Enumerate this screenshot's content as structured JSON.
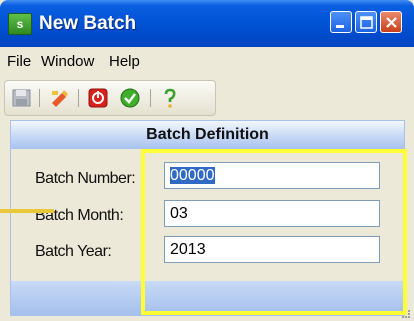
{
  "window": {
    "title": "New Batch",
    "icon_letter": "s"
  },
  "menu": {
    "items": [
      {
        "label": "File"
      },
      {
        "label": "Window"
      },
      {
        "label": "Help"
      }
    ]
  },
  "toolbar": {
    "icons": [
      "save-icon",
      "edit-icon",
      "stop-icon",
      "ok-icon",
      "help-icon"
    ]
  },
  "panel": {
    "title": "Batch Definition",
    "fields": [
      {
        "label": "Batch Number:",
        "value": "00000",
        "selected": true
      },
      {
        "label": "Batch Month:",
        "value": "03"
      },
      {
        "label": "Batch Year:",
        "value": "2013"
      }
    ]
  },
  "colors": {
    "highlight": "#ffff33",
    "title_bar": "#0254d7",
    "selection": "#316ac5"
  }
}
